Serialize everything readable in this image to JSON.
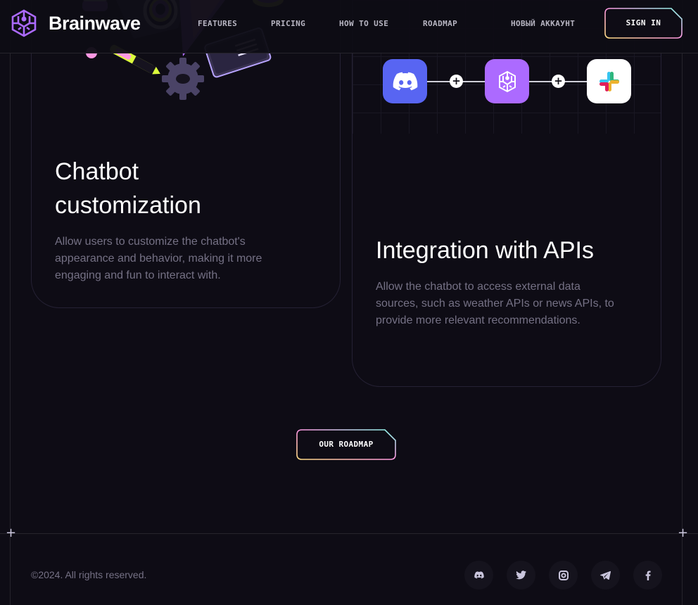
{
  "header": {
    "brand": "Brainwave",
    "nav": [
      "FEATURES",
      "PRICING",
      "HOW TO USE",
      "ROADMAP"
    ],
    "new_account": "НОВЫЙ АККАУНТ",
    "sign_in": "SIGN IN"
  },
  "cards": [
    {
      "title_line1": "Chatbot",
      "title_line2": "customization",
      "description_line1": "Allow users to customize the chatbot's",
      "description_line2": "appearance and behavior, making it more",
      "description_line3": "engaging and fun to interact with."
    },
    {
      "title": "Integration with APIs",
      "description_line1": "Allow the chatbot to access external data",
      "description_line2": "sources, such as weather APIs or news APIs, to",
      "description_line3": "provide more relevant recommendations.",
      "integrations": [
        "discord-icon",
        "brainwave-icon",
        "slack-icon"
      ]
    }
  ],
  "roadmap_button": "OUR ROADMAP",
  "footer": {
    "copyright": "©2024. All rights reserved.",
    "socials": [
      "discord-icon",
      "twitter-icon",
      "instagram-icon",
      "telegram-icon",
      "facebook-icon"
    ]
  },
  "colors": {
    "background": "#0e0c15",
    "muted_text": "#757185",
    "accent_purple": "#ac6aff",
    "discord_blue": "#5865f2"
  }
}
